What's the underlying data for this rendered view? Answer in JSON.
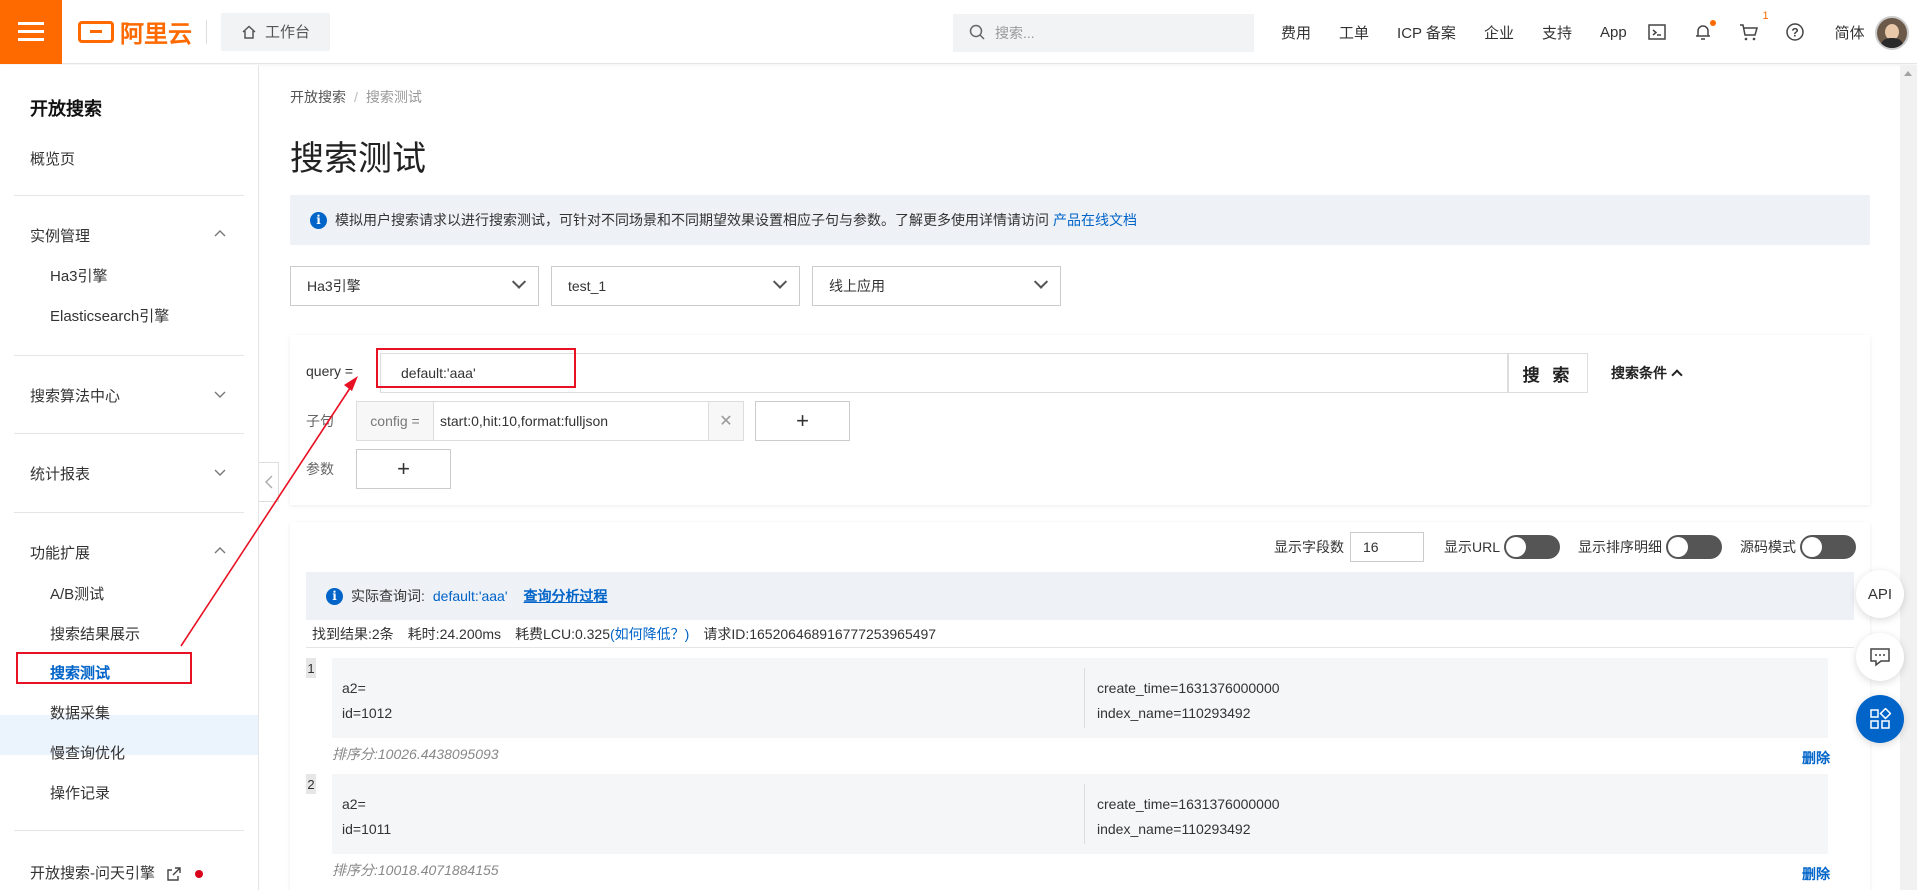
{
  "header": {
    "brand": "阿里云",
    "workbench": "工作台",
    "search_placeholder": "搜索...",
    "links": [
      "费用",
      "工单",
      "ICP 备案",
      "企业",
      "支持",
      "App"
    ],
    "cart_count": "1",
    "language": "简体",
    "brand_color": "#ff6a00"
  },
  "sidebar": {
    "title": "开放搜索",
    "overview": "概览页",
    "instance_mgmt": "实例管理",
    "instance_items": [
      "Ha3引擎",
      "Elasticsearch引擎"
    ],
    "algo_center": "搜索算法中心",
    "stats_report": "统计报表",
    "extensions": "功能扩展",
    "extension_items": [
      "A/B测试",
      "搜索结果展示",
      "搜索测试",
      "数据采集",
      "慢查询优化",
      "操作记录"
    ],
    "bottom_link": "开放搜索-问天引擎"
  },
  "breadcrumb": {
    "root": "开放搜索",
    "current": "搜索测试"
  },
  "page": {
    "title": "搜索测试",
    "info_text": "模拟用户搜索请求以进行搜索测试，可针对不同场景和不同期望效果设置相应子句与参数。了解更多使用详情请访问",
    "info_link": "产品在线文档"
  },
  "selects": {
    "engine": "Ha3引擎",
    "app": "test_1",
    "env": "线上应用"
  },
  "query": {
    "label": "query =",
    "value": "default:'aaa'",
    "search_button": "搜 索",
    "conditions": "搜索条件",
    "clause_label": "子句",
    "config_key": "config =",
    "config_value": "start:0,hit:10,format:fulljson",
    "params_label": "参数"
  },
  "result_options": {
    "field_count_label": "显示字段数",
    "field_count": "16",
    "show_url": "显示URL",
    "show_rank_detail": "显示排序明细",
    "source_mode": "源码模式"
  },
  "actual_query": {
    "label": "实际查询词:",
    "value": "default:'aaa'",
    "link": "查询分析过程"
  },
  "stats": {
    "found": "找到结果:2条",
    "time": "耗时:24.200ms",
    "lcu_prefix": "耗费LCU:0.325",
    "lcu_link": "(如何降低？)",
    "request_id": "请求ID:165206468916777253965497"
  },
  "documents": [
    {
      "index": "1",
      "left": [
        "a2=",
        "id=1012"
      ],
      "right": [
        "create_time=1631376000000",
        "index_name=110293492"
      ],
      "score": "排序分:10026.4438095093",
      "delete": "删除"
    },
    {
      "index": "2",
      "left": [
        "a2=",
        "id=1011"
      ],
      "right": [
        "create_time=1631376000000",
        "index_name=110293492"
      ],
      "score": "排序分:10018.4071884155",
      "delete": "删除"
    }
  ],
  "floating": {
    "api": "API"
  }
}
